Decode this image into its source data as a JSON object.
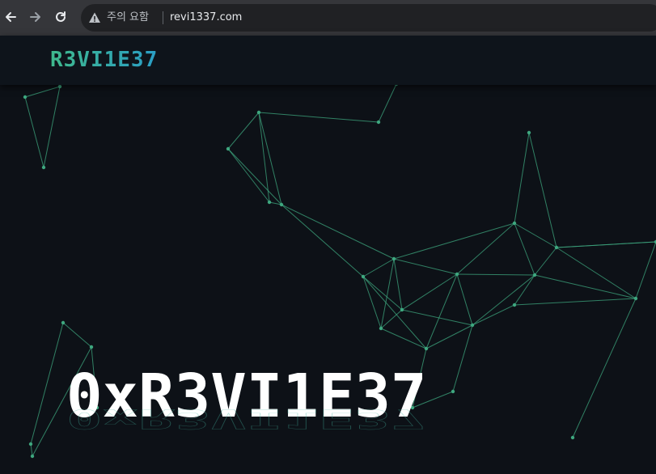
{
  "browser": {
    "security_warning": "주의 요함",
    "url": "revi1337.com"
  },
  "site": {
    "brand": "R3VI1E37",
    "hero_title": "0xR3VI1E37"
  },
  "colors": {
    "background": "#0d1117",
    "network_line": "#3ea77f",
    "brand_gradient_start": "#3fb98c",
    "brand_gradient_end": "#2a9ec6"
  }
}
